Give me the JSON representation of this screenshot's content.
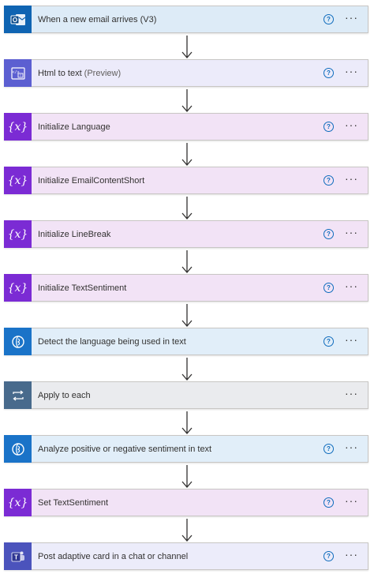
{
  "steps": [
    {
      "title": "When a new email arrives (V3)",
      "suffix": "",
      "icon": "outlook-icon",
      "theme": "t-outlook",
      "help": true,
      "more": "···"
    },
    {
      "title": "Html to text",
      "suffix": " (Preview)",
      "icon": "html-to-text-icon",
      "theme": "t-html",
      "help": true,
      "more": "···"
    },
    {
      "title": "Initialize Language",
      "suffix": "",
      "icon": "variable-icon",
      "theme": "t-var",
      "help": true,
      "more": "···"
    },
    {
      "title": "Initialize EmailContentShort",
      "suffix": "",
      "icon": "variable-icon",
      "theme": "t-var",
      "help": true,
      "more": "···"
    },
    {
      "title": "Initialize LineBreak",
      "suffix": "",
      "icon": "variable-icon",
      "theme": "t-var",
      "help": true,
      "more": "···"
    },
    {
      "title": "Initialize TextSentiment",
      "suffix": "",
      "icon": "variable-icon",
      "theme": "t-var",
      "help": true,
      "more": "···"
    },
    {
      "title": "Detect the language being used in text",
      "suffix": "",
      "icon": "ai-builder-icon",
      "theme": "t-ai",
      "help": true,
      "more": "···"
    },
    {
      "title": "Apply to each",
      "suffix": "",
      "icon": "loop-icon",
      "theme": "t-apply",
      "help": false,
      "more": "···"
    },
    {
      "title": "Analyze positive or negative sentiment in text",
      "suffix": "",
      "icon": "ai-builder-icon",
      "theme": "t-ai",
      "help": true,
      "more": "···"
    },
    {
      "title": "Set TextSentiment",
      "suffix": "",
      "icon": "variable-icon",
      "theme": "t-var",
      "help": true,
      "more": "···"
    },
    {
      "title": "Post adaptive card in a chat or channel",
      "suffix": "",
      "icon": "teams-icon",
      "theme": "t-teams",
      "help": true,
      "more": "···"
    }
  ],
  "help_glyph": "?",
  "variable_glyph": "{x}"
}
